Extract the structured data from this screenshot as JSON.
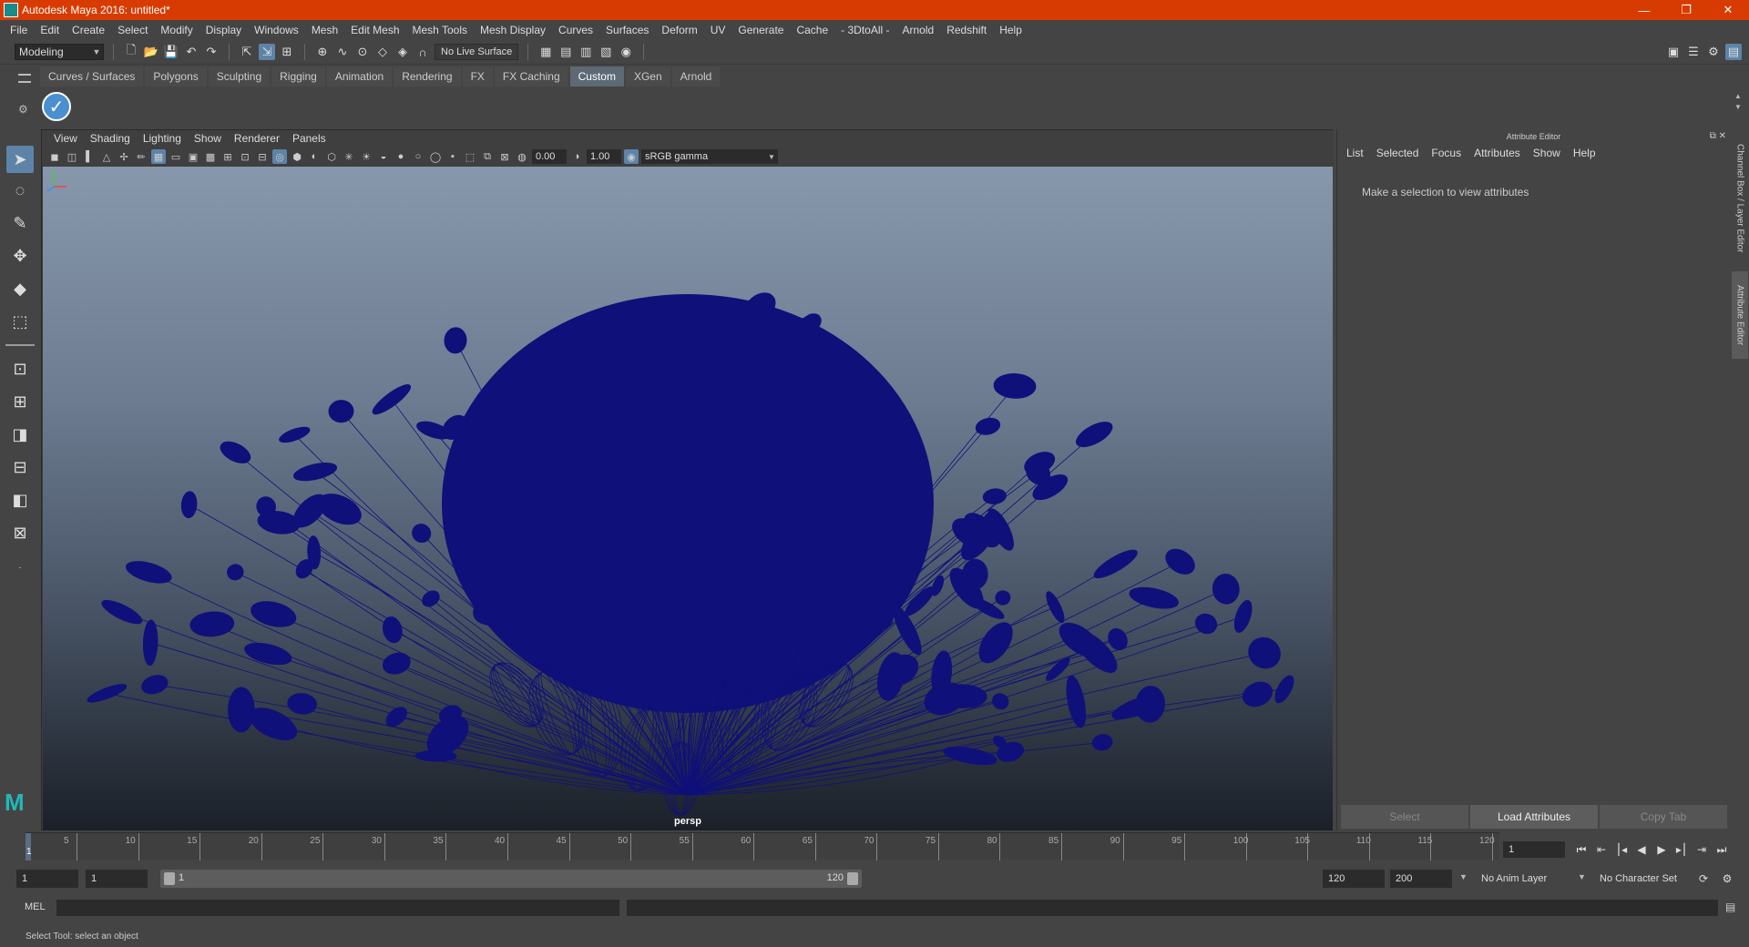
{
  "window": {
    "title": "Autodesk Maya 2016: untitled*",
    "controls": [
      "—",
      "❐",
      "✕"
    ]
  },
  "menubar": [
    "File",
    "Edit",
    "Create",
    "Select",
    "Modify",
    "Display",
    "Windows",
    "Mesh",
    "Edit Mesh",
    "Mesh Tools",
    "Mesh Display",
    "Curves",
    "Surfaces",
    "Deform",
    "UV",
    "Generate",
    "Cache",
    "- 3DtoAll -",
    "Arnold",
    "Redshift",
    "Help"
  ],
  "statusline": {
    "mode": "Modeling",
    "live_surface": "No Live Surface"
  },
  "shelf": {
    "tabs": [
      "Curves / Surfaces",
      "Polygons",
      "Sculpting",
      "Rigging",
      "Animation",
      "Rendering",
      "FX",
      "FX Caching",
      "Custom",
      "XGen",
      "Arnold"
    ],
    "active_tab": "Custom"
  },
  "viewport": {
    "menus": [
      "View",
      "Shading",
      "Lighting",
      "Show",
      "Renderer",
      "Panels"
    ],
    "exposure": "0.00",
    "gamma": "1.00",
    "color_space": "sRGB gamma",
    "camera_label": "persp",
    "wireframe_color": "#10107a"
  },
  "attribute_editor": {
    "title": "Attribute Editor",
    "menus": [
      "List",
      "Selected",
      "Focus",
      "Attributes",
      "Show",
      "Help"
    ],
    "message": "Make a selection to view attributes",
    "buttons": {
      "select": "Select",
      "load": "Load Attributes",
      "copy": "Copy Tab"
    }
  },
  "side_tabs": {
    "channel_box": "Channel Box / Layer Editor",
    "attribute_editor": "Attribute Editor"
  },
  "timeline": {
    "ticks": [
      "5",
      "10",
      "15",
      "20",
      "25",
      "30",
      "35",
      "40",
      "45",
      "50",
      "55",
      "60",
      "65",
      "70",
      "75",
      "80",
      "85",
      "90",
      "95",
      "100",
      "105",
      "110",
      "115",
      "120"
    ],
    "current_frame_label": "1",
    "current_frame": "1"
  },
  "range": {
    "start": "1",
    "playback_start": "1",
    "slider_start": "1",
    "slider_end": "120",
    "playback_end": "120",
    "end": "200",
    "anim_layer": "No Anim Layer",
    "character_set": "No Character Set"
  },
  "cmdline": {
    "label": "MEL"
  },
  "helpline": {
    "text": "Select Tool: select an object"
  }
}
